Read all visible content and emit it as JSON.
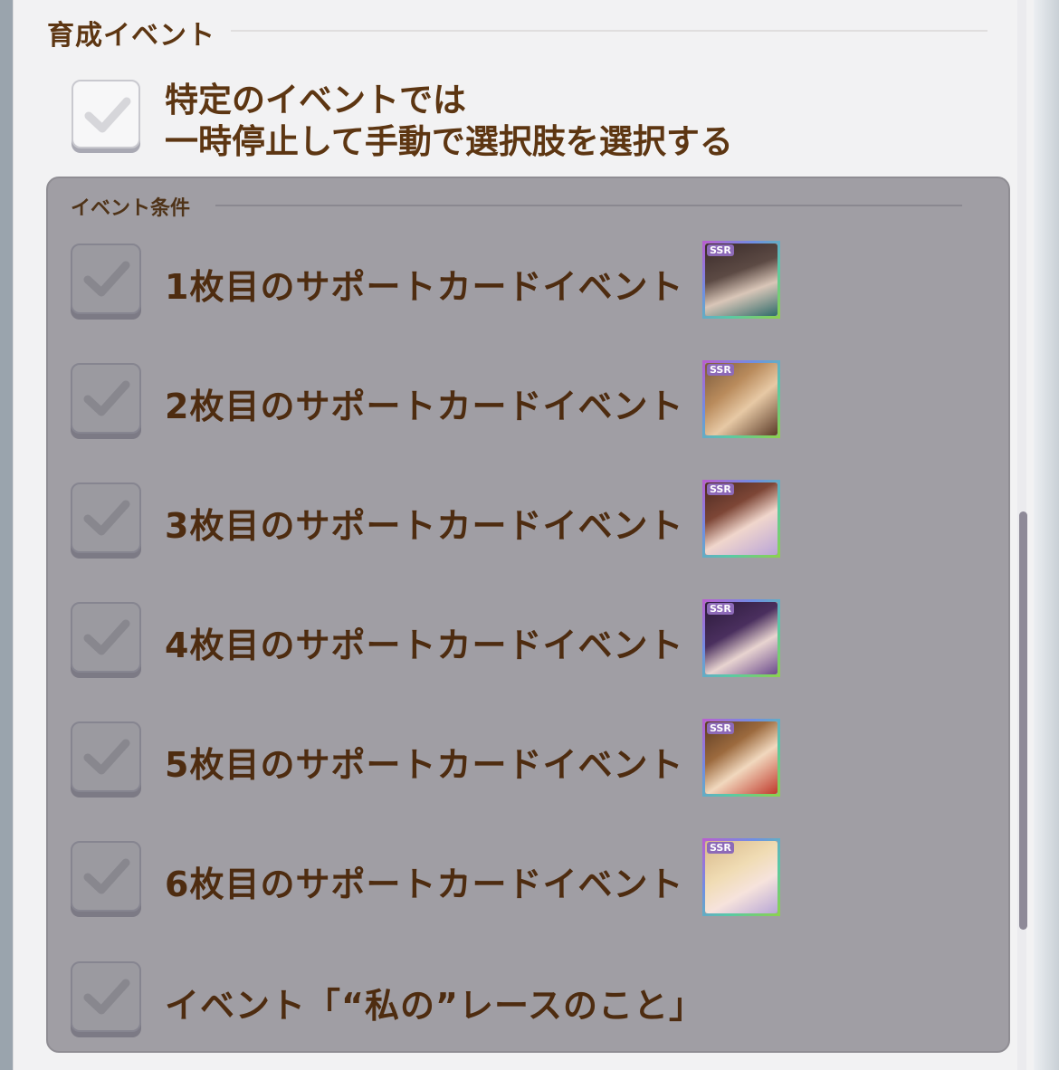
{
  "section": {
    "title": "育成イベント"
  },
  "master_option": {
    "line1": "特定のイベントでは",
    "line2": "一時停止して手動で選択肢を選択する",
    "checked": true
  },
  "conditions": {
    "title": "イベント条件",
    "rows": [
      {
        "label": "1枚目のサポートカードイベント",
        "rarity": "SSR",
        "checked": true
      },
      {
        "label": "2枚目のサポートカードイベント",
        "rarity": "SSR",
        "checked": true
      },
      {
        "label": "3枚目のサポートカードイベント",
        "rarity": "SSR",
        "checked": true
      },
      {
        "label": "4枚目のサポートカードイベント",
        "rarity": "SSR",
        "checked": true
      },
      {
        "label": "5枚目のサポートカードイベント",
        "rarity": "SSR",
        "checked": true
      },
      {
        "label": "6枚目のサポートカードイベント",
        "rarity": "SSR",
        "checked": true
      }
    ],
    "race_event": {
      "label": "イベント「“私の”レースのこと」",
      "checked": true
    }
  },
  "colors": {
    "title_brown": "#5d3612",
    "panel_bg": "#f2f2f3",
    "disabled_overlay": "#a09ea4",
    "scroll_thumb": "#8e8a98"
  },
  "icons": {
    "checkmark": "check-icon",
    "card": "support-card-thumbnail"
  }
}
